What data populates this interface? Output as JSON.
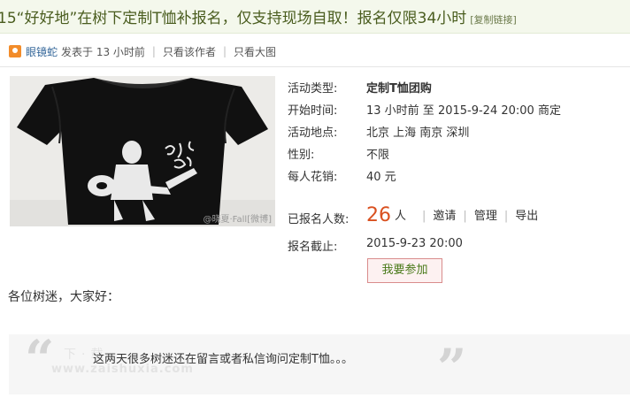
{
  "thread": {
    "title": "15“好好地”在树下定制T恤补报名，仅支持现场自取！报名仅限34小时",
    "copy_link": "[复制链接]"
  },
  "meta": {
    "author": "眼镜蛇",
    "posted": "发表于 13 小时前",
    "author_only": "只看该作者",
    "big_image": "只看大图"
  },
  "photo": {
    "watermark": "@晓夏·Fall[微博]"
  },
  "activity": {
    "type_label": "活动类型:",
    "type_value": "定制T恤团购",
    "start_label": "开始时间:",
    "start_value": "13 小时前 至 2015-9-24 20:00 商定",
    "place_label": "活动地点:",
    "place_value": "北京 上海 南京 深圳",
    "gender_label": "性别:",
    "gender_value": "不限",
    "cost_label": "每人花销:",
    "cost_value": "40 元",
    "count_label": "已报名人数:",
    "count_value": "26",
    "count_unit": "人",
    "op_invite": "邀请",
    "op_manage": "管理",
    "op_export": "导出",
    "deadline_label": "报名截止:",
    "deadline_value": "2015-9-23 20:00",
    "join_button": "我要参加"
  },
  "body": {
    "greeting": "各位树迷，大家好：",
    "quote": "这两天很多树迷还在留言或者私信询问定制T恤。。。",
    "watermark_line1": "下·载",
    "watermark_line2": "www.zaishuxia.com"
  },
  "colors": {
    "title_bg": "#f4f8ec",
    "title_text": "#4a5d1f",
    "count_accent": "#d9501f",
    "join_border": "#d98c8c"
  },
  "icons": [
    "avatar-icon",
    "open-quote-icon",
    "close-quote-icon"
  ]
}
